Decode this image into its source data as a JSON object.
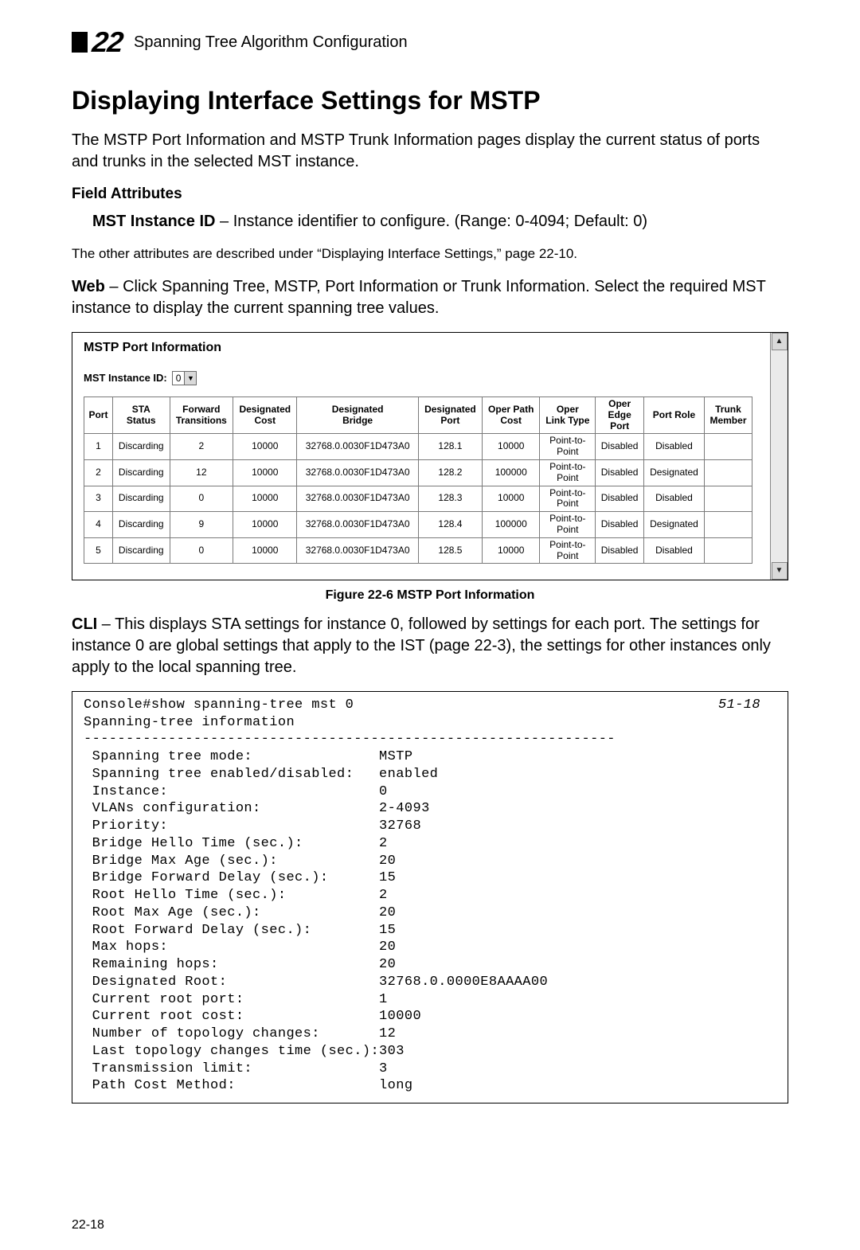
{
  "chapter": {
    "number": "22",
    "running_title": "Spanning Tree Algorithm Configuration"
  },
  "heading": "Displaying Interface Settings for MSTP",
  "intro_para": "The MSTP Port Information and MSTP Trunk Information pages display the current status of ports and trunks in the selected MST instance.",
  "field_attr_heading": "Field Attributes",
  "field_attr_item_label": "MST Instance ID",
  "field_attr_item_desc": " – Instance identifier to configure. (Range: 0-4094; Default: 0)",
  "other_attrs_note": "The other attributes are described under “Displaying Interface Settings,” page 22-10.",
  "web_prefix": "Web",
  "web_para": " – Click Spanning Tree, MSTP, Port Information or Trunk Information. Select the required MST instance to display the current spanning tree values.",
  "panel": {
    "title": "MSTP Port Information",
    "instance_label": "MST Instance ID:",
    "instance_value": "0",
    "headers": [
      "Port",
      "STA\nStatus",
      "Forward\nTransitions",
      "Designated\nCost",
      "Designated\nBridge",
      "Designated\nPort",
      "Oper Path\nCost",
      "Oper\nLink Type",
      "Oper\nEdge\nPort",
      "Port Role",
      "Trunk\nMember"
    ],
    "rows": [
      {
        "c0": "1",
        "c1": "Discarding",
        "c2": "2",
        "c3": "10000",
        "c4": "32768.0.0030F1D473A0",
        "c5": "128.1",
        "c6": "10000",
        "c7": "Point-to-\nPoint",
        "c8": "Disabled",
        "c9": "Disabled",
        "c10": ""
      },
      {
        "c0": "2",
        "c1": "Discarding",
        "c2": "12",
        "c3": "10000",
        "c4": "32768.0.0030F1D473A0",
        "c5": "128.2",
        "c6": "100000",
        "c7": "Point-to-\nPoint",
        "c8": "Disabled",
        "c9": "Designated",
        "c10": ""
      },
      {
        "c0": "3",
        "c1": "Discarding",
        "c2": "0",
        "c3": "10000",
        "c4": "32768.0.0030F1D473A0",
        "c5": "128.3",
        "c6": "10000",
        "c7": "Point-to-\nPoint",
        "c8": "Disabled",
        "c9": "Disabled",
        "c10": ""
      },
      {
        "c0": "4",
        "c1": "Discarding",
        "c2": "9",
        "c3": "10000",
        "c4": "32768.0.0030F1D473A0",
        "c5": "128.4",
        "c6": "100000",
        "c7": "Point-to-\nPoint",
        "c8": "Disabled",
        "c9": "Designated",
        "c10": ""
      },
      {
        "c0": "5",
        "c1": "Discarding",
        "c2": "0",
        "c3": "10000",
        "c4": "32768.0.0030F1D473A0",
        "c5": "128.5",
        "c6": "10000",
        "c7": "Point-to-\nPoint",
        "c8": "Disabled",
        "c9": "Disabled",
        "c10": ""
      }
    ]
  },
  "figure_caption": "Figure 22-6  MSTP Port Information",
  "cli_prefix": "CLI",
  "cli_para": " – This displays STA settings for instance 0, followed by settings for each port. The settings for instance 0 are global settings that apply to the IST (page 22-3), the settings for other instances only apply to the local spanning tree.",
  "code_ref": "51-18",
  "code_text": "Console#show spanning-tree mst 0\nSpanning-tree information\n---------------------------------------------------------------\n Spanning tree mode:               MSTP\n Spanning tree enabled/disabled:   enabled\n Instance:                         0\n VLANs configuration:              2-4093\n Priority:                         32768\n Bridge Hello Time (sec.):         2\n Bridge Max Age (sec.):            20\n Bridge Forward Delay (sec.):      15\n Root Hello Time (sec.):           2\n Root Max Age (sec.):              20\n Root Forward Delay (sec.):        15\n Max hops:                         20\n Remaining hops:                   20\n Designated Root:                  32768.0.0000E8AAAA00\n Current root port:                1\n Current root cost:                10000\n Number of topology changes:       12\n Last topology changes time (sec.):303\n Transmission limit:               3\n Path Cost Method:                 long",
  "page_number": "22-18"
}
